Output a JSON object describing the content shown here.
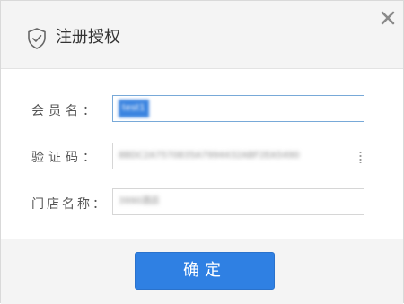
{
  "dialog": {
    "title": "注册授权",
    "title_icon": "shield-check-icon",
    "close_icon": "close-icon"
  },
  "form": {
    "member_label": "会员名：",
    "member_value": "test1",
    "code_label": "验证码：",
    "code_value": "8BDC2A7570835A7994432ABF2EA5490",
    "store_label": "门店名称：",
    "store_value": "3990酒店"
  },
  "footer": {
    "confirm_label": "确定",
    "confirm_color": "#2f80e3"
  }
}
